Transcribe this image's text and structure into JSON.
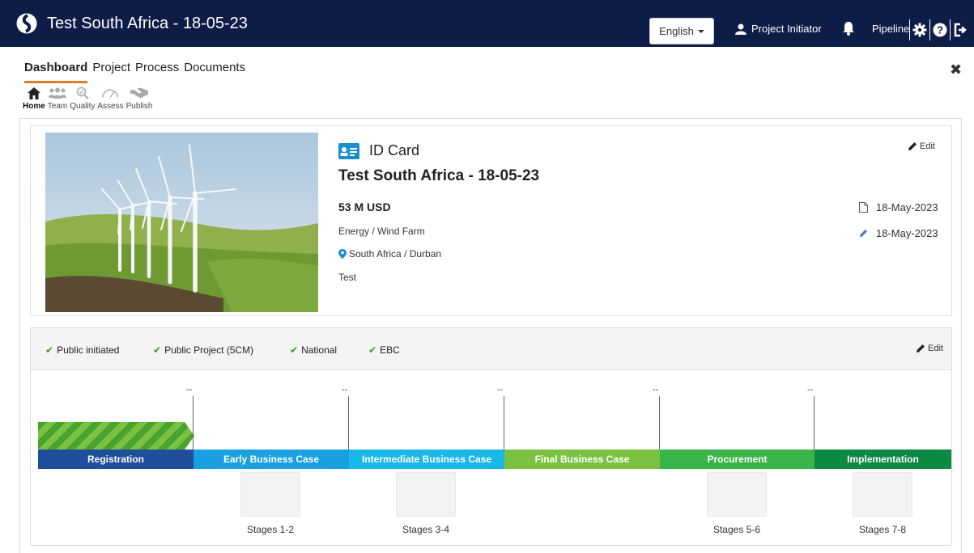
{
  "header": {
    "title": "Test South Africa - 18-05-23",
    "language": "English",
    "user_role": "Project Initiator",
    "pipeline_label": "Pipeline"
  },
  "tabs": [
    {
      "label": "Dashboard",
      "active": true
    },
    {
      "label": "Project",
      "active": false
    },
    {
      "label": "Process",
      "active": false
    },
    {
      "label": "Documents",
      "active": false
    }
  ],
  "subnav": [
    {
      "label": "Home",
      "icon": "home-icon",
      "active": true
    },
    {
      "label": "Team",
      "icon": "team-icon",
      "active": false
    },
    {
      "label": "Quality",
      "icon": "quality-icon",
      "active": false
    },
    {
      "label": "Assess",
      "icon": "gauge-icon",
      "active": false
    },
    {
      "label": "Publish",
      "icon": "handshake-icon",
      "active": false
    }
  ],
  "id_card": {
    "heading": "ID Card",
    "project_title": "Test South Africa - 18-05-23",
    "cost": "53 M USD",
    "sector": "Energy / Wind Farm",
    "location": "South Africa / Durban",
    "note": "Test",
    "edit_label": "Edit",
    "created_date": "18-May-2023",
    "modified_date": "18-May-2023"
  },
  "timeline": {
    "tags": [
      "Public initiated",
      "Public Project (5CM)",
      "National",
      "EBC"
    ],
    "edit_label": "Edit",
    "marker_dashes": [
      "--",
      "--",
      "--",
      "--",
      "--"
    ],
    "stages": [
      {
        "label": "Registration",
        "color": "#1f4e9b"
      },
      {
        "label": "Early Business Case",
        "color": "#1aa0e0"
      },
      {
        "label": "Intermediate Business Case",
        "color": "#1ab8e8"
      },
      {
        "label": "Final Business Case",
        "color": "#7cc242"
      },
      {
        "label": "Procurement",
        "color": "#38b449"
      },
      {
        "label": "Implementation",
        "color": "#0c8a43"
      }
    ],
    "stage_groups": [
      "Stages 1-2",
      "Stages 3-4",
      "Stages 5-6",
      "Stages 7-8"
    ]
  },
  "colors": {
    "header_bg": "#0e1d47",
    "active_tab_underline": "#e07a2e",
    "check_green": "#3a9a1e",
    "stripe_green": "#7cc242"
  }
}
